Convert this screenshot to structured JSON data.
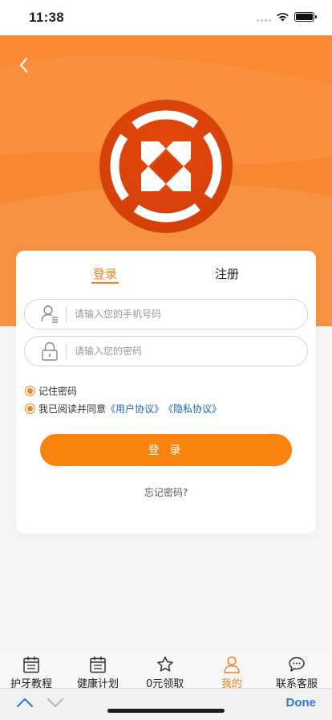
{
  "status_bar": {
    "time": "11:38"
  },
  "header": {
    "back_icon": "chevron-left-icon",
    "logo_icon": "brand-logo"
  },
  "tabs": {
    "login": "登录",
    "register": "注册",
    "active": "login"
  },
  "form": {
    "phone": {
      "placeholder": "请输入您的手机号码",
      "value": "",
      "icon": "user-list-icon"
    },
    "password": {
      "placeholder": "请输入您的密码",
      "value": "",
      "icon": "lock-icon"
    },
    "remember_label": "记住密码",
    "agree_prefix": "我已阅读并同意",
    "user_agreement": "《用户协议》",
    "privacy_policy": "《隐私协议》",
    "login_button": "登 录",
    "forgot": "忘记密码?"
  },
  "tabbar": {
    "items": [
      {
        "label": "护牙教程",
        "icon": "calendar-icon"
      },
      {
        "label": "健康计划",
        "icon": "calendar-icon"
      },
      {
        "label": "0元领取",
        "icon": "star-icon"
      },
      {
        "label": "我的",
        "icon": "person-icon",
        "active": true
      },
      {
        "label": "联系客服",
        "icon": "chat-bubble-icon"
      }
    ]
  },
  "keyboard_accessory": {
    "done": "Done"
  },
  "colors": {
    "accent": "#f5811f",
    "button": "#fa8310",
    "header": "#f98a33",
    "link": "#1a64c8"
  }
}
